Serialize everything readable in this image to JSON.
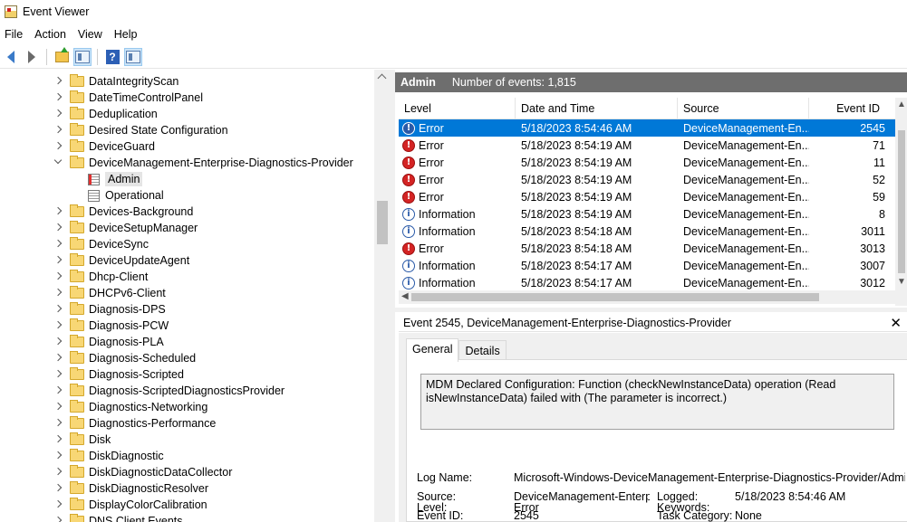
{
  "window": {
    "title": "Event Viewer"
  },
  "menu": [
    "File",
    "Action",
    "View",
    "Help"
  ],
  "toolbar": {
    "icons": [
      "back-arrow-icon",
      "forward-arrow-icon",
      "up-folder-icon",
      "show-hide-console-tree-icon",
      "help-icon",
      "show-hide-action-pane-icon"
    ],
    "help_glyph": "?"
  },
  "tree": {
    "items": [
      {
        "label": "DataIntegrityScan",
        "type": "folder",
        "expanded": false
      },
      {
        "label": "DateTimeControlPanel",
        "type": "folder",
        "expanded": false
      },
      {
        "label": "Deduplication",
        "type": "folder",
        "expanded": false
      },
      {
        "label": "Desired State Configuration",
        "type": "folder",
        "expanded": false
      },
      {
        "label": "DeviceGuard",
        "type": "folder",
        "expanded": false
      },
      {
        "label": "DeviceManagement-Enterprise-Diagnostics-Provider",
        "type": "folder",
        "expanded": true
      },
      {
        "label": "Admin",
        "type": "log",
        "selected": true
      },
      {
        "label": "Operational",
        "type": "log"
      },
      {
        "label": "Devices-Background",
        "type": "folder",
        "expanded": false
      },
      {
        "label": "DeviceSetupManager",
        "type": "folder",
        "expanded": false
      },
      {
        "label": "DeviceSync",
        "type": "folder",
        "expanded": false
      },
      {
        "label": "DeviceUpdateAgent",
        "type": "folder",
        "expanded": false
      },
      {
        "label": "Dhcp-Client",
        "type": "folder",
        "expanded": false
      },
      {
        "label": "DHCPv6-Client",
        "type": "folder",
        "expanded": false
      },
      {
        "label": "Diagnosis-DPS",
        "type": "folder",
        "expanded": false
      },
      {
        "label": "Diagnosis-PCW",
        "type": "folder",
        "expanded": false
      },
      {
        "label": "Diagnosis-PLA",
        "type": "folder",
        "expanded": false
      },
      {
        "label": "Diagnosis-Scheduled",
        "type": "folder",
        "expanded": false
      },
      {
        "label": "Diagnosis-Scripted",
        "type": "folder",
        "expanded": false
      },
      {
        "label": "Diagnosis-ScriptedDiagnosticsProvider",
        "type": "folder",
        "expanded": false
      },
      {
        "label": "Diagnostics-Networking",
        "type": "folder",
        "expanded": false
      },
      {
        "label": "Diagnostics-Performance",
        "type": "folder",
        "expanded": false
      },
      {
        "label": "Disk",
        "type": "folder",
        "expanded": false
      },
      {
        "label": "DiskDiagnostic",
        "type": "folder",
        "expanded": false
      },
      {
        "label": "DiskDiagnosticDataCollector",
        "type": "folder",
        "expanded": false
      },
      {
        "label": "DiskDiagnosticResolver",
        "type": "folder",
        "expanded": false
      },
      {
        "label": "DisplayColorCalibration",
        "type": "folder",
        "expanded": false
      },
      {
        "label": "DNS Client Events",
        "type": "folder",
        "expanded": false
      }
    ]
  },
  "events": {
    "log_name": "Admin",
    "count_text": "Number of events: 1,815",
    "columns": [
      "Level",
      "Date and Time",
      "Source",
      "Event ID"
    ],
    "rows": [
      {
        "level": "Error",
        "date": "5/18/2023 8:54:46 AM",
        "source": "DeviceManagement-En...",
        "id": "2545",
        "selected": true
      },
      {
        "level": "Error",
        "date": "5/18/2023 8:54:19 AM",
        "source": "DeviceManagement-En...",
        "id": "71"
      },
      {
        "level": "Error",
        "date": "5/18/2023 8:54:19 AM",
        "source": "DeviceManagement-En...",
        "id": "11"
      },
      {
        "level": "Error",
        "date": "5/18/2023 8:54:19 AM",
        "source": "DeviceManagement-En...",
        "id": "52"
      },
      {
        "level": "Error",
        "date": "5/18/2023 8:54:19 AM",
        "source": "DeviceManagement-En...",
        "id": "59"
      },
      {
        "level": "Information",
        "date": "5/18/2023 8:54:19 AM",
        "source": "DeviceManagement-En...",
        "id": "8"
      },
      {
        "level": "Information",
        "date": "5/18/2023 8:54:18 AM",
        "source": "DeviceManagement-En...",
        "id": "3011"
      },
      {
        "level": "Error",
        "date": "5/18/2023 8:54:18 AM",
        "source": "DeviceManagement-En...",
        "id": "3013"
      },
      {
        "level": "Information",
        "date": "5/18/2023 8:54:17 AM",
        "source": "DeviceManagement-En...",
        "id": "3007"
      },
      {
        "level": "Information",
        "date": "5/18/2023 8:54:17 AM",
        "source": "DeviceManagement-En...",
        "id": "3012"
      }
    ]
  },
  "details": {
    "title": "Event 2545, DeviceManagement-Enterprise-Diagnostics-Provider",
    "close_glyph": "✕",
    "tabs": [
      "General",
      "Details"
    ],
    "active_tab": "General",
    "message": "MDM Declared Configuration: Function (checkNewInstanceData) operation (Read isNewInstanceData) failed with (The parameter is incorrect.)",
    "fields": {
      "log_name_label": "Log Name:",
      "log_name_value": "Microsoft-Windows-DeviceManagement-Enterprise-Diagnostics-Provider/Admin",
      "source_label": "Source:",
      "source_value": "DeviceManagement-Enterpr",
      "logged_label": "Logged:",
      "logged_value": "5/18/2023 8:54:46 AM",
      "event_id_label": "Event ID:",
      "event_id_value": "2545",
      "task_category_label": "Task Category:",
      "task_category_value": "None",
      "level_label": "Level:",
      "level_value": "Error",
      "keywords_label": "Keywords:",
      "keywords_value": ""
    }
  },
  "colors": {
    "selection": "#0078d7",
    "header_bar": "#6e6e6e",
    "error_icon": "#d42424",
    "info_icon": "#2a5aa8"
  }
}
